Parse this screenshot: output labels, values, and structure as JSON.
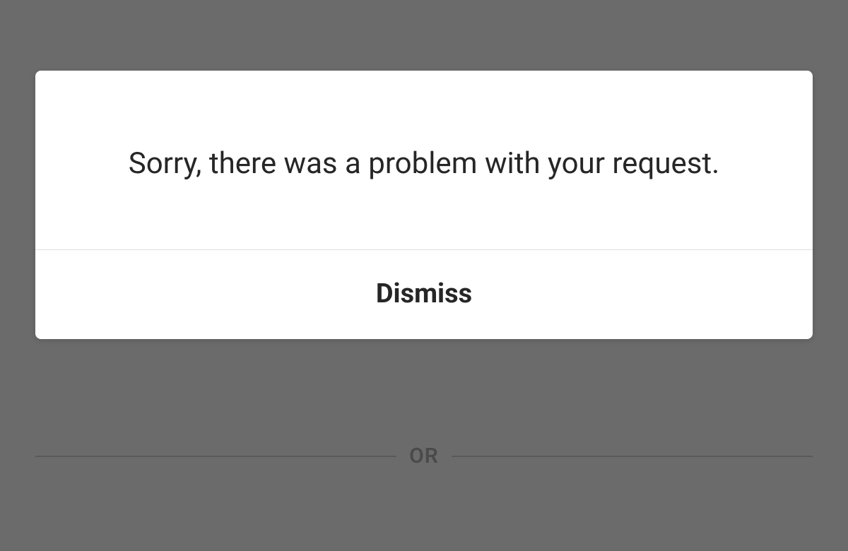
{
  "dialog": {
    "message": "Sorry, there was a problem with your request.",
    "dismiss_label": "Dismiss"
  },
  "background": {
    "separator_text": "OR"
  }
}
